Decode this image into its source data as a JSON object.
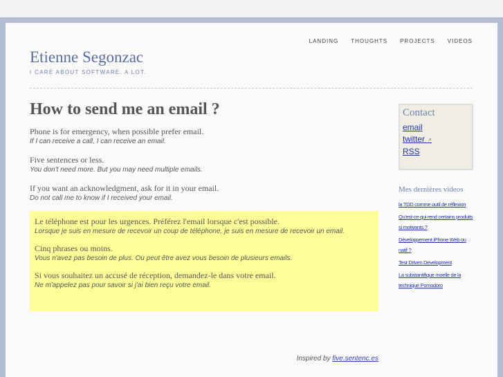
{
  "nav": [
    "LANDING",
    "THOUGHTS",
    "PROJECTS",
    "VIDEOS"
  ],
  "site": {
    "title": "Etienne Segonzac",
    "tagline": "I CARE ABOUT SOFTWARE. A LOT."
  },
  "post": {
    "title": "How to send me an email ?",
    "rules": [
      {
        "text": "Phone is for emergency, when possible prefer email.",
        "sub": "If I can receive a call, I can receive an email."
      },
      {
        "text": "Five sentences or less.",
        "sub": "You don't need more. But you may need multiple emails."
      },
      {
        "text": "If you want an acknowledgment, ask for it in your email.",
        "sub": "Do not call me to know if I received your email."
      }
    ],
    "rules_fr": [
      {
        "text": "Le téléphone est pour les urgences. Préférez l'email lorsque c'est possible.",
        "sub": "Lorsque je suis en mesure de recevoir un coup de téléphone, je suis en mesure de recevoir un email."
      },
      {
        "text": "Cinq phrases ou moins.",
        "sub": "Vous n'avez pas besoin de plus. Ou peut être avez vous besoin de plusieurs emails."
      },
      {
        "text": "Si vous souhaitez un accusé de réception, demandez-le dans votre email.",
        "sub": "Ne m'appelez pas pour savoir si j'ai bien reçu votre email."
      }
    ],
    "inspired_prefix": "Inspired by",
    "inspired_link": "five.sentenc.es"
  },
  "sidebar": {
    "contact_title": "Contact",
    "contact_links": [
      "email",
      "twitter",
      "RSS"
    ],
    "videos_title": "Mes dernières videos",
    "videos": [
      "la TDD comme outil de réflexion",
      "Qu'est-ce qui rend certains produits si motivants ?",
      "Développement iPhone Web ou natif ?",
      "Test Driven Development",
      "La substantifique moelle de la technique Pomodoro"
    ]
  }
}
